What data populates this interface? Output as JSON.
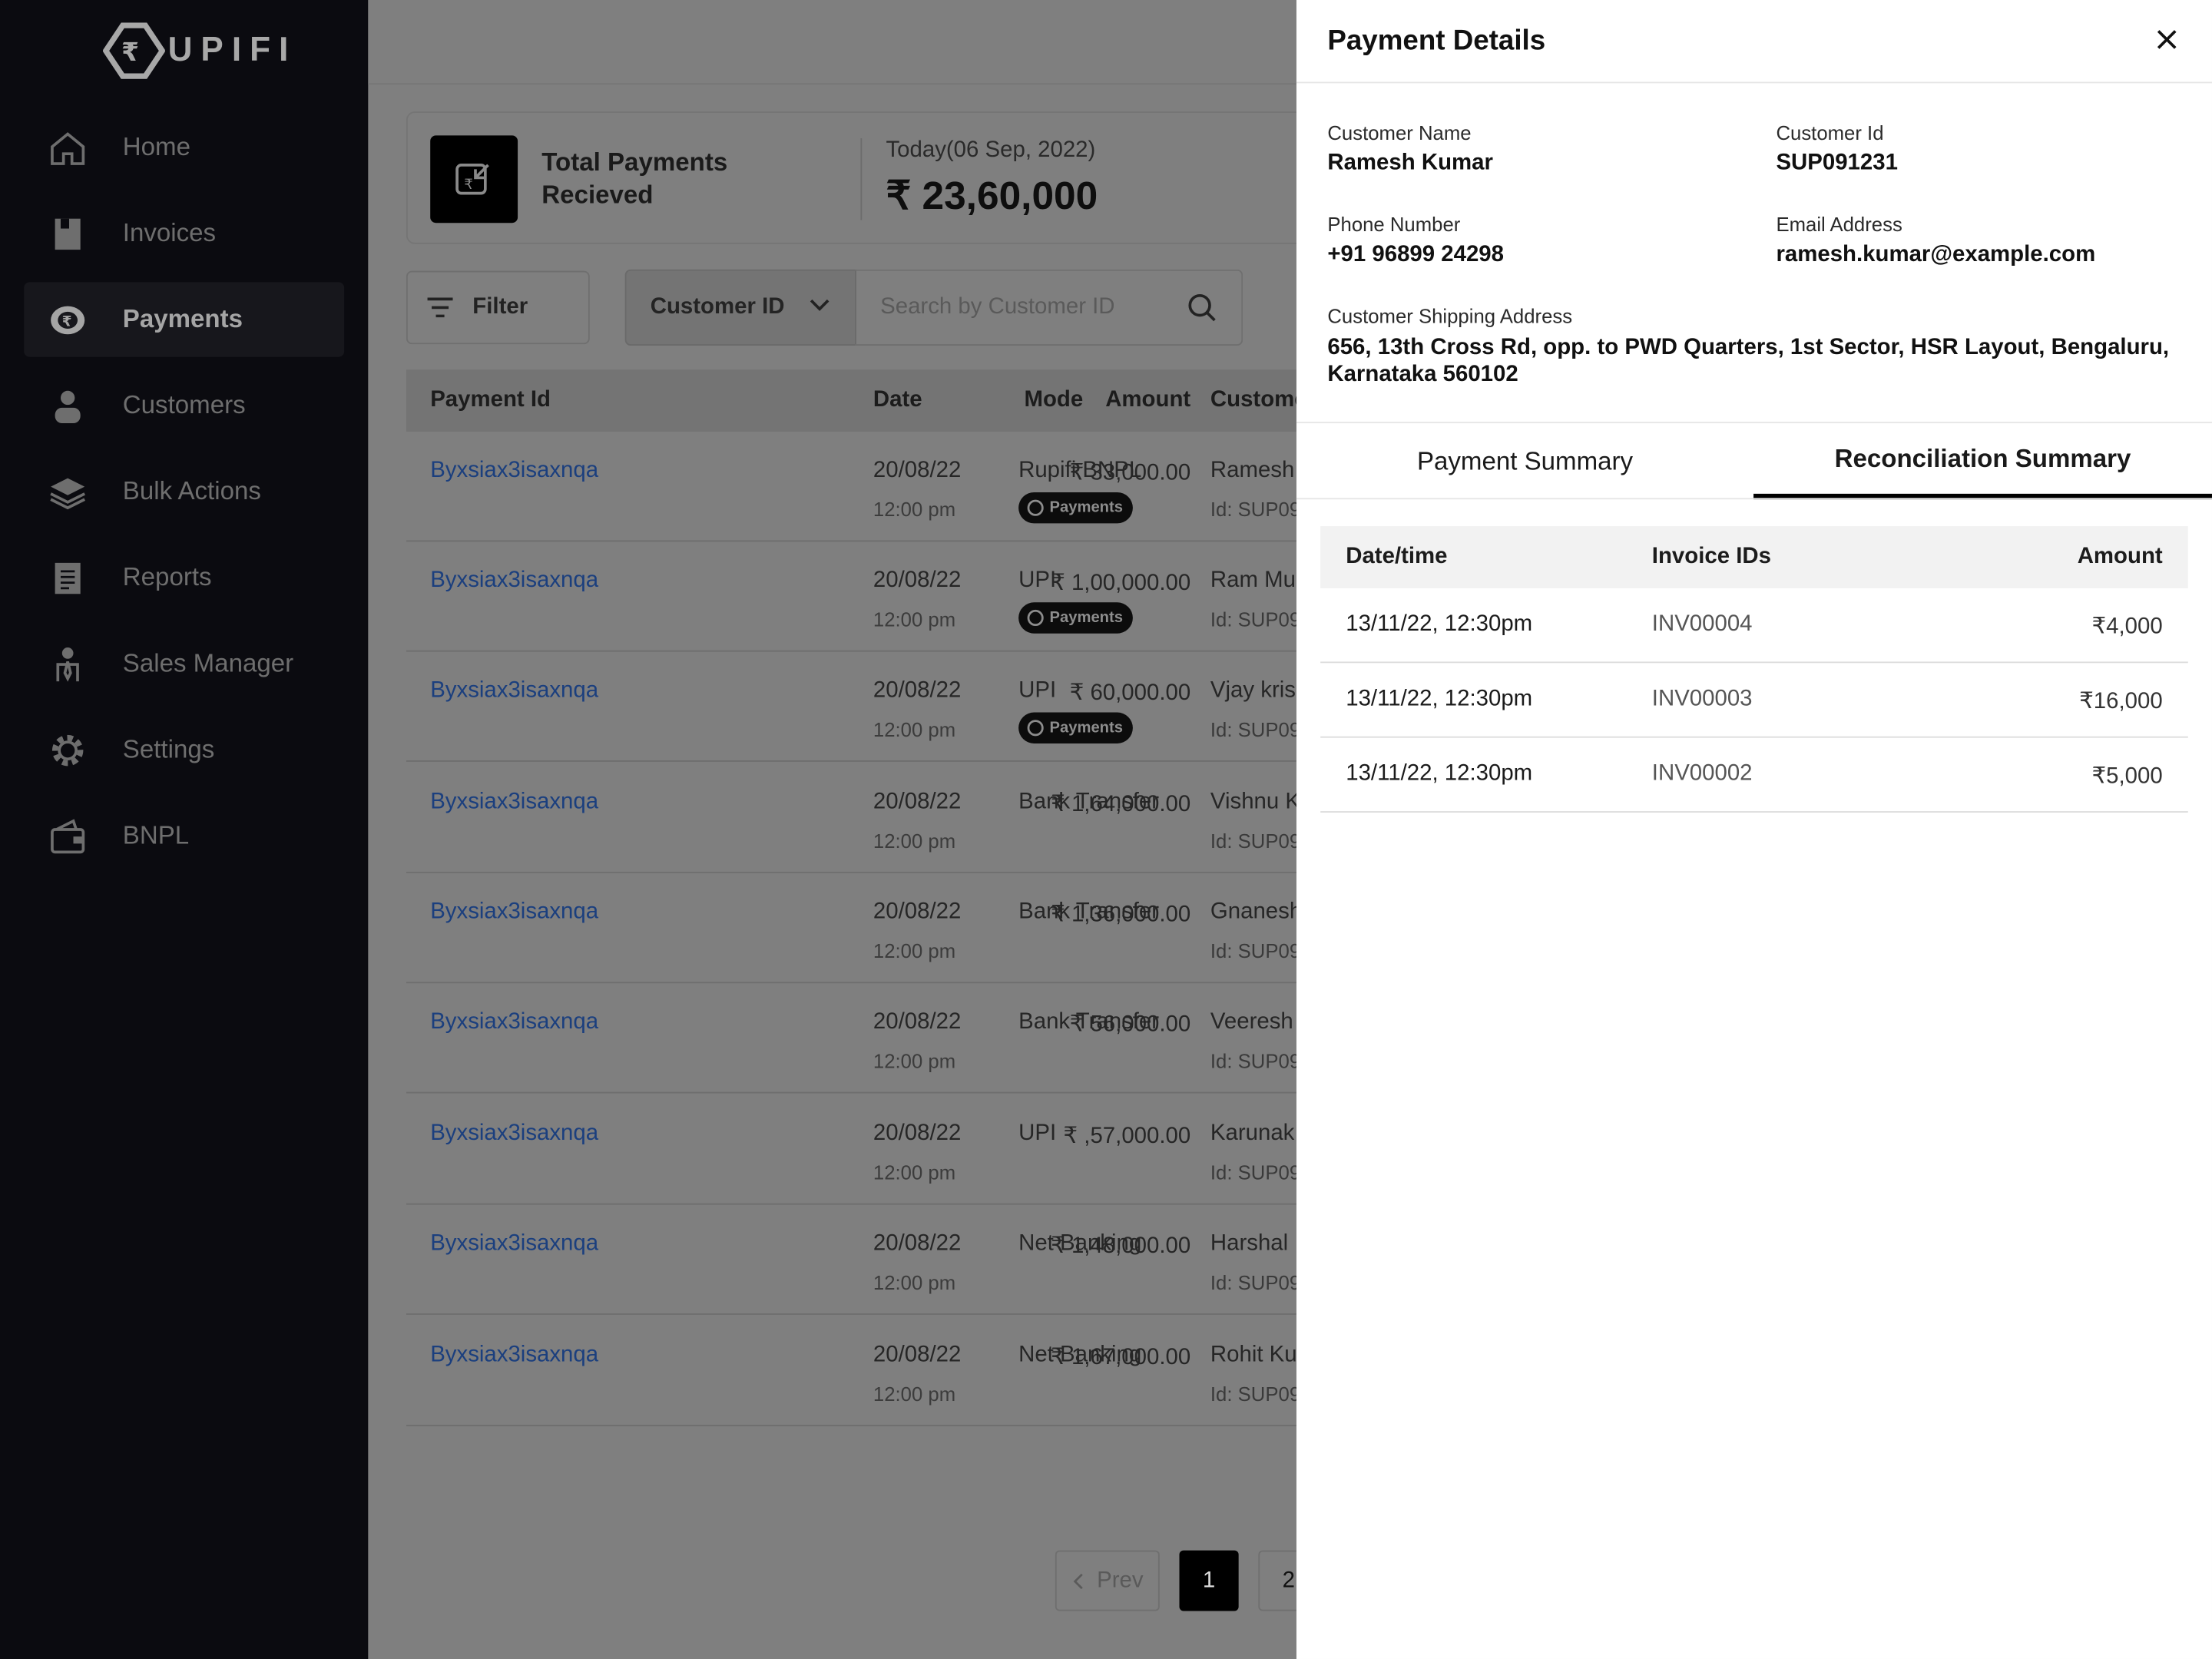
{
  "brand": {
    "name": "UPIFI"
  },
  "sidebar": {
    "items": [
      {
        "label": "Home",
        "icon": "home-icon"
      },
      {
        "label": "Invoices",
        "icon": "invoice-icon"
      },
      {
        "label": "Payments",
        "icon": "rupee-coin-icon",
        "active": true
      },
      {
        "label": "Customers",
        "icon": "user-icon"
      },
      {
        "label": "Bulk Actions",
        "icon": "layers-icon"
      },
      {
        "label": "Reports",
        "icon": "report-icon"
      },
      {
        "label": "Sales Manager",
        "icon": "manager-icon"
      },
      {
        "label": "Settings",
        "icon": "gear-icon"
      },
      {
        "label": "BNPL",
        "icon": "wallet-icon"
      }
    ]
  },
  "summary": {
    "title": "Total Payments Recieved",
    "date": "Today(06 Sep, 2022)",
    "amount": "₹ 23,60,000"
  },
  "toolbar": {
    "filter_label": "Filter",
    "select_value": "Customer ID",
    "search_placeholder": "Search by Customer ID"
  },
  "table": {
    "headers": {
      "payment_id": "Payment Id",
      "amount": "Amount",
      "date": "Date",
      "mode": "Mode",
      "customer": "Custome"
    },
    "badge_label": "Payments",
    "rows": [
      {
        "pid": "Byxsiax3isaxnqa",
        "amount": "₹ 33,000.00",
        "date": "20/08/22",
        "time": "12:00 pm",
        "mode": "Rupifi BNPL",
        "badge": true,
        "cname": "Ramesh",
        "cid": "Id: SUP09"
      },
      {
        "pid": "Byxsiax3isaxnqa",
        "amount": "₹ 1,00,000.00",
        "date": "20/08/22",
        "time": "12:00 pm",
        "mode": "UPI",
        "badge": true,
        "cname": "Ram Mur",
        "cid": "Id: SUP09"
      },
      {
        "pid": "Byxsiax3isaxnqa",
        "amount": "₹ 60,000.00",
        "date": "20/08/22",
        "time": "12:00 pm",
        "mode": "UPI",
        "badge": true,
        "cname": "Vjay kris",
        "cid": "Id: SUP09"
      },
      {
        "pid": "Byxsiax3isaxnqa",
        "amount": "₹ 1,64,000.00",
        "date": "20/08/22",
        "time": "12:00 pm",
        "mode": "Bank Transfer",
        "badge": false,
        "cname": "Vishnu K",
        "cid": "Id: SUP09"
      },
      {
        "pid": "Byxsiax3isaxnqa",
        "amount": "₹ 1,36,000.00",
        "date": "20/08/22",
        "time": "12:00 pm",
        "mode": "Bank Transfer",
        "badge": false,
        "cname": "Gnanesh",
        "cid": "Id: SUP09"
      },
      {
        "pid": "Byxsiax3isaxnqa",
        "amount": "₹ 56,000.00",
        "date": "20/08/22",
        "time": "12:00 pm",
        "mode": "Bank Transfer",
        "badge": false,
        "cname": "Veeresh",
        "cid": "Id: SUP09"
      },
      {
        "pid": "Byxsiax3isaxnqa",
        "amount": "₹ ,57,000.00",
        "date": "20/08/22",
        "time": "12:00 pm",
        "mode": "UPI",
        "badge": false,
        "cname": "Karunak",
        "cid": "Id: SUP09"
      },
      {
        "pid": "Byxsiax3isaxnqa",
        "amount": "₹ 1,48,000.00",
        "date": "20/08/22",
        "time": "12:00 pm",
        "mode": "Net Banking",
        "badge": false,
        "cname": "Harshal",
        "cid": "Id: SUP09"
      },
      {
        "pid": "Byxsiax3isaxnqa",
        "amount": "₹ 1,67,000.00",
        "date": "20/08/22",
        "time": "12:00 pm",
        "mode": "Net Banking",
        "badge": false,
        "cname": "Rohit Ku",
        "cid": "Id: SUP09"
      }
    ]
  },
  "pagination": {
    "prev_label": "Prev",
    "pages": [
      "1",
      "2"
    ],
    "current_page": "1"
  },
  "panel": {
    "title": "Payment Details",
    "customer_name_label": "Customer Name",
    "customer_name": "Ramesh Kumar",
    "customer_id_label": "Customer Id",
    "customer_id": "SUP091231",
    "phone_label": "Phone Number",
    "phone": "+91 96899 24298",
    "email_label": "Email Address",
    "email": "ramesh.kumar@example.com",
    "address_label": "Customer Shipping Address",
    "address": "656, 13th Cross Rd, opp. to PWD Quarters, 1st Sector, HSR Layout, Bengaluru, Karnataka 560102",
    "tabs": [
      {
        "label": "Payment Summary",
        "active": false
      },
      {
        "label": "Reconciliation Summary",
        "active": true
      }
    ],
    "recon": {
      "headers": {
        "datetime": "Date/time",
        "invoice_ids": "Invoice IDs",
        "amount": "Amount"
      },
      "rows": [
        {
          "datetime": "13/11/22, 12:30pm",
          "invoice": "INV00004",
          "amount": "₹4,000"
        },
        {
          "datetime": "13/11/22, 12:30pm",
          "invoice": "INV00003",
          "amount": "₹16,000"
        },
        {
          "datetime": "13/11/22, 12:30pm",
          "invoice": "INV00002",
          "amount": "₹5,000"
        }
      ]
    }
  }
}
